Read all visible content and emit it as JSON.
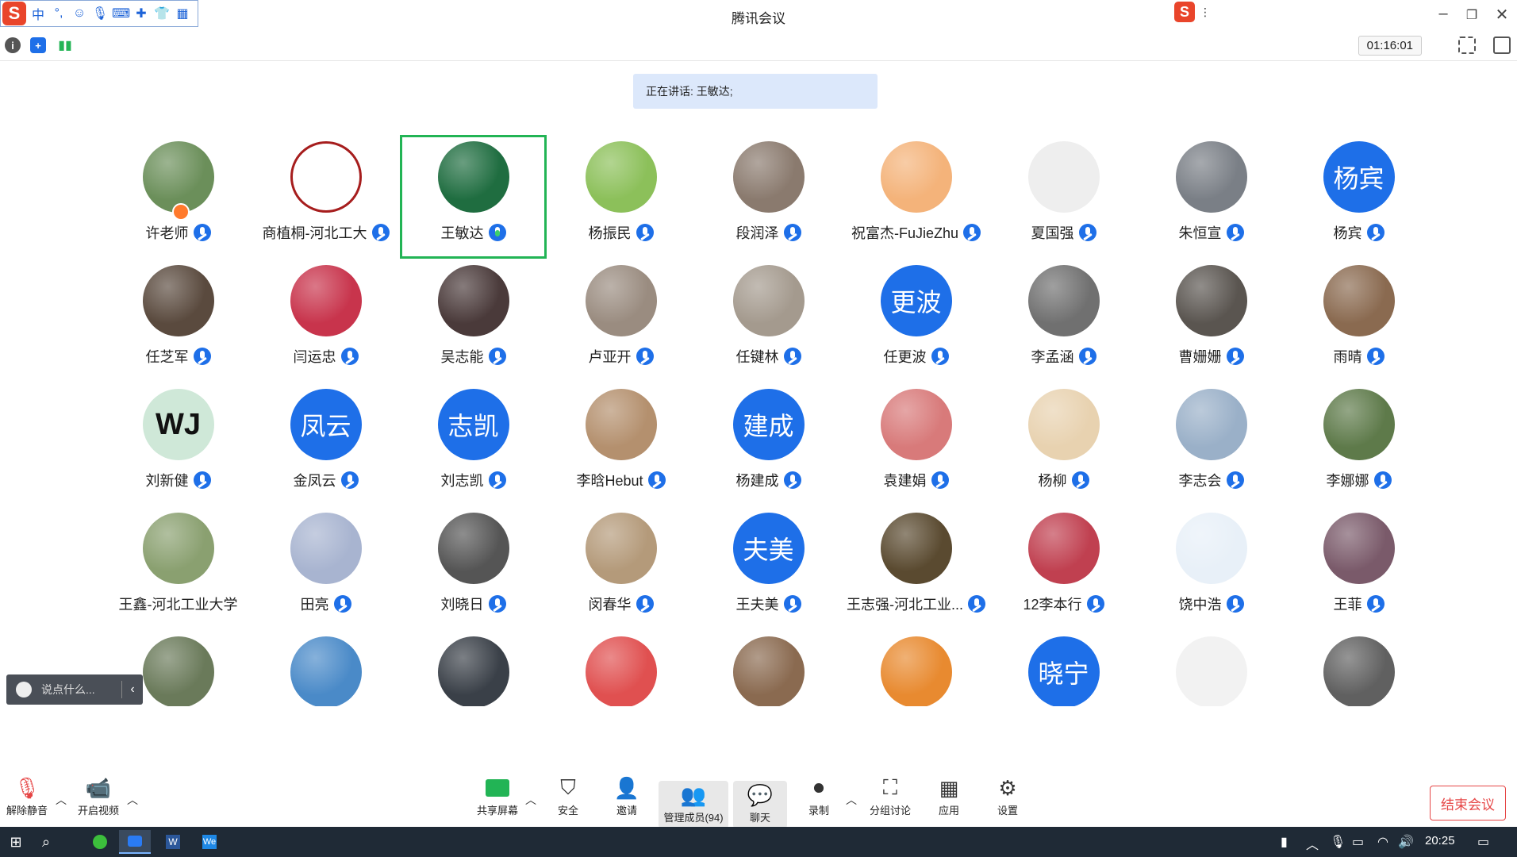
{
  "window": {
    "title": "腾讯会议"
  },
  "ime": {
    "mode": "中",
    "punct": "°,"
  },
  "timer": "01:16:01",
  "speaking": "正在讲话: 王敏达;",
  "participants": [
    {
      "name": "许老师",
      "style": "photo",
      "color": "#6b8f5a",
      "host": true
    },
    {
      "name": "商植桐-河北工大",
      "style": "logo",
      "color": "#a61d1d"
    },
    {
      "name": "王敏达",
      "style": "photo",
      "color": "#1f6d40",
      "active": true,
      "speaking": true
    },
    {
      "name": "杨振民",
      "style": "photo",
      "color": "#8cc05a"
    },
    {
      "name": "段润泽",
      "style": "photo",
      "color": "#8a7a6e"
    },
    {
      "name": "祝富杰-FuJieZhu",
      "style": "photo",
      "color": "#f4b37a"
    },
    {
      "name": "夏国强",
      "style": "sketch",
      "color": "#eeeeee"
    },
    {
      "name": "朱恒宣",
      "style": "photo",
      "color": "#7a7f86"
    },
    {
      "name": "杨宾",
      "style": "text",
      "text": "杨宾",
      "color": "#1e6fe8"
    },
    {
      "name": "任芝军",
      "style": "photo",
      "color": "#5a4a3e"
    },
    {
      "name": "闫运忠",
      "style": "photo",
      "color": "#c8344c"
    },
    {
      "name": "吴志能",
      "style": "photo",
      "color": "#4a3a3a"
    },
    {
      "name": "卢亚开",
      "style": "photo",
      "color": "#9a8c80"
    },
    {
      "name": "任键林",
      "style": "photo",
      "color": "#a49a8e"
    },
    {
      "name": "任更波",
      "style": "text",
      "text": "更波",
      "color": "#1e6fe8"
    },
    {
      "name": "李孟涵",
      "style": "photo",
      "color": "#707070"
    },
    {
      "name": "曹姗姗",
      "style": "photo",
      "color": "#5a5550"
    },
    {
      "name": "雨晴",
      "style": "photo",
      "color": "#8a6a50"
    },
    {
      "name": "刘新健",
      "style": "mono",
      "text": "WJ",
      "color": "#cfe8d8"
    },
    {
      "name": "金凤云",
      "style": "text",
      "text": "凤云",
      "color": "#1e6fe8"
    },
    {
      "name": "刘志凯",
      "style": "text",
      "text": "志凯",
      "color": "#1e6fe8"
    },
    {
      "name": "李晗Hebut",
      "style": "photo",
      "color": "#b4906e"
    },
    {
      "name": "杨建成",
      "style": "text",
      "text": "建成",
      "color": "#1e6fe8"
    },
    {
      "name": "袁建娟",
      "style": "photo",
      "color": "#d87a7a"
    },
    {
      "name": "杨柳",
      "style": "photo",
      "color": "#e8d2b0"
    },
    {
      "name": "李志会",
      "style": "photo",
      "color": "#9ab0c8"
    },
    {
      "name": "李娜娜",
      "style": "photo",
      "color": "#5e7a4a"
    },
    {
      "name": "王鑫-河北工业大学",
      "style": "photo",
      "color": "#8aa070",
      "nomic": true
    },
    {
      "name": "田亮",
      "style": "photo",
      "color": "#a8b4d0"
    },
    {
      "name": "刘晓日",
      "style": "photo",
      "color": "#555555"
    },
    {
      "name": "闵春华",
      "style": "photo",
      "color": "#b49a7a"
    },
    {
      "name": "王夫美",
      "style": "text",
      "text": "夫美",
      "color": "#1e6fe8"
    },
    {
      "name": "王志强-河北工业...",
      "style": "photo",
      "color": "#5a4a30"
    },
    {
      "name": "12李本行",
      "style": "photo",
      "color": "#c04050"
    },
    {
      "name": "饶中浩",
      "style": "photo",
      "color": "#e8f0f8"
    },
    {
      "name": "王菲",
      "style": "photo",
      "color": "#7a5a6a"
    },
    {
      "name": "",
      "style": "photo",
      "color": "#6a7a5a"
    },
    {
      "name": "",
      "style": "photo",
      "color": "#4a8ac8"
    },
    {
      "name": "",
      "style": "photo",
      "color": "#3a4048"
    },
    {
      "name": "",
      "style": "photo",
      "color": "#e05050"
    },
    {
      "name": "",
      "style": "photo",
      "color": "#8a6a50"
    },
    {
      "name": "",
      "style": "photo",
      "color": "#e88a30"
    },
    {
      "name": "",
      "style": "text",
      "text": "晓宁",
      "color": "#1e6fe8"
    },
    {
      "name": "",
      "style": "sketch",
      "color": "#f2f2f2"
    },
    {
      "name": "",
      "style": "photo",
      "color": "#606060"
    }
  ],
  "chat": {
    "placeholder": "说点什么..."
  },
  "toolbar": {
    "unmute": "解除静音",
    "video": "开启视频",
    "share": "共享屏幕",
    "security": "安全",
    "invite": "邀请",
    "members": "管理成员(94)",
    "chat": "聊天",
    "record": "录制",
    "breakout": "分组讨论",
    "apps": "应用",
    "settings": "设置",
    "end": "结束会议"
  },
  "taskbar": {
    "time": "20:25"
  }
}
